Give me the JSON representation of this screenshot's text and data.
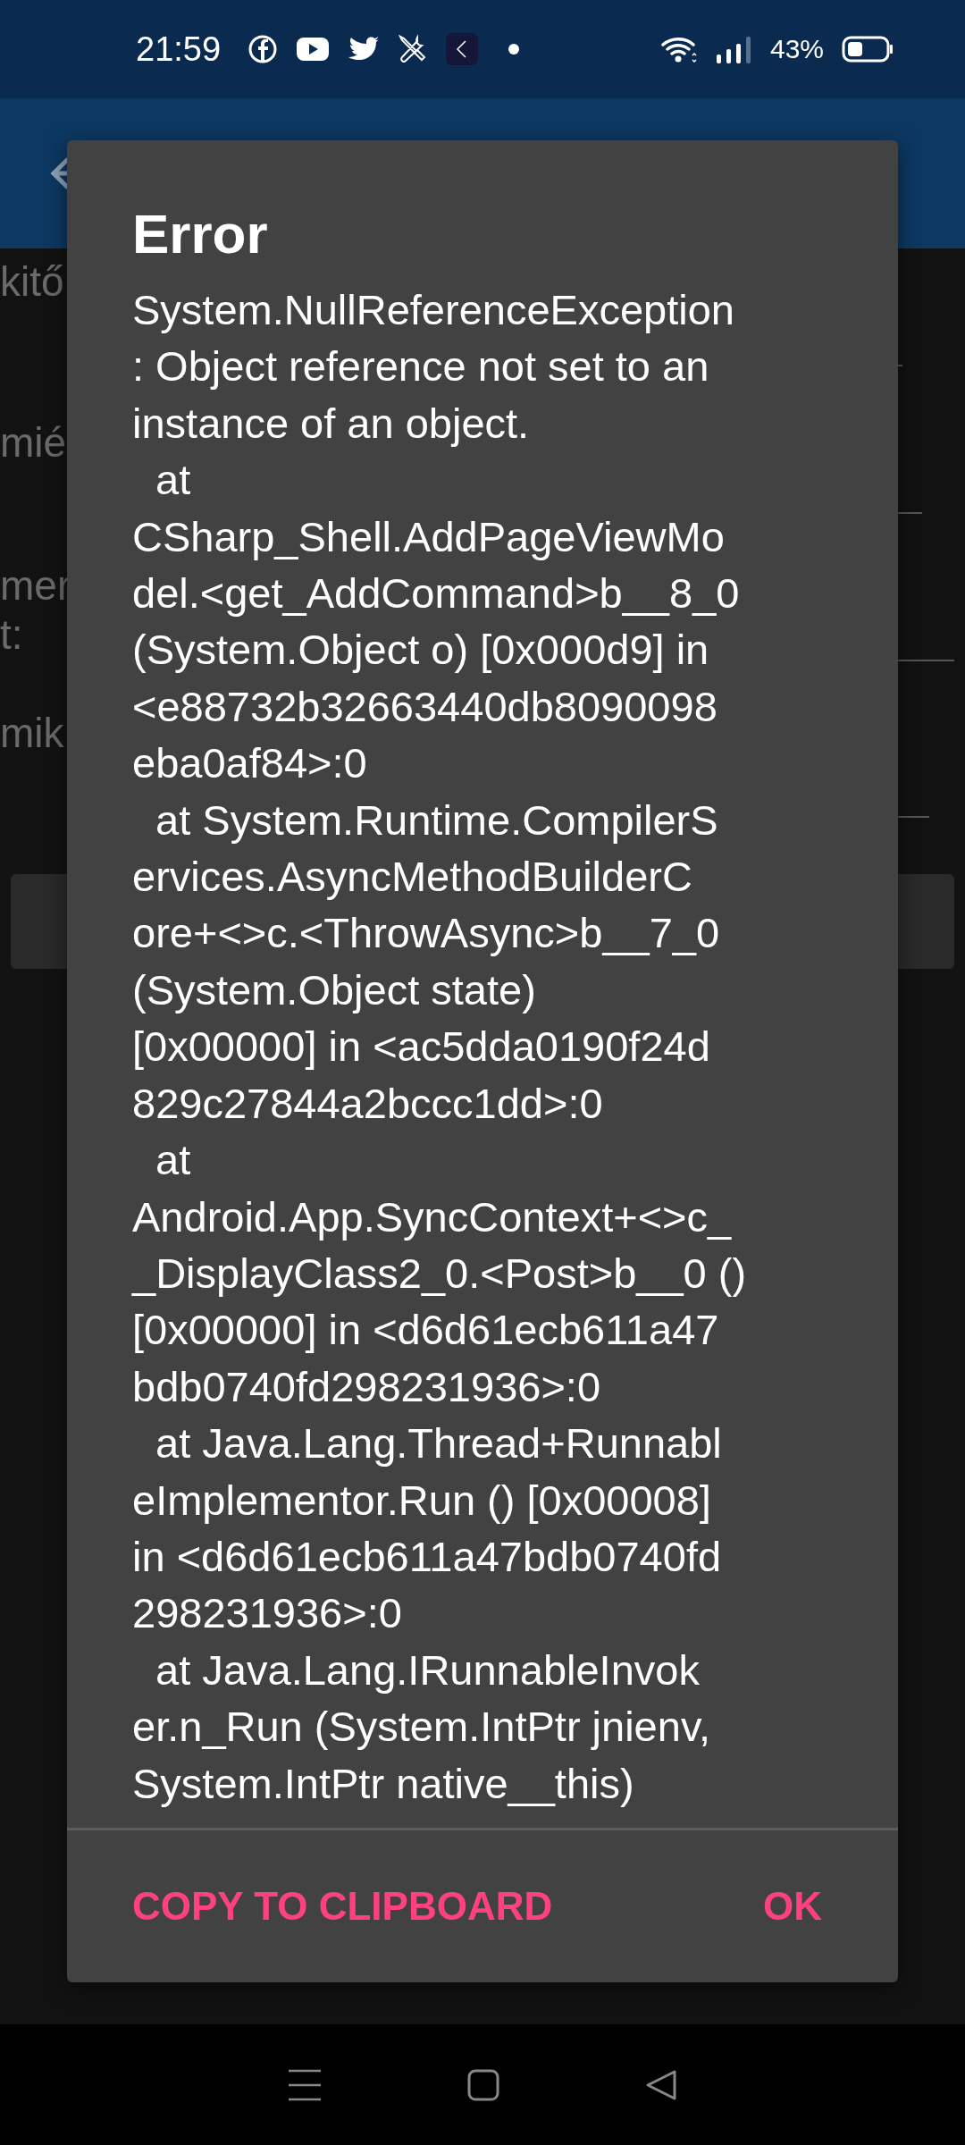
{
  "status_bar": {
    "time": "21:59",
    "battery": "43%"
  },
  "background": {
    "labels": [
      "kitő",
      "mié",
      "mer",
      "t:",
      "mik"
    ]
  },
  "dialog": {
    "title": "Error",
    "message": "System.NullReferenceException\n: Object reference not set to an\ninstance of an object.\n  at\nCSharp_Shell.AddPageViewMo\ndel.<get_AddCommand>b__8_0\n(System.Object o) [0x000d9] in\n<e88732b32663440db8090098\neba0af84>:0\n  at System.Runtime.CompilerS\nervices.AsyncMethodBuilderC\nore+<>c.<ThrowAsync>b__7_0\n(System.Object state)\n[0x00000] in <ac5dda0190f24d\n829c27844a2bccc1dd>:0\n  at\nAndroid.App.SyncContext+<>c_\n_DisplayClass2_0.<Post>b__0 ()\n[0x00000] in <d6d61ecb611a47\nbdb0740fd298231936>:0\n  at Java.Lang.Thread+Runnabl\neImplementor.Run () [0x00008]\nin <d6d61ecb611a47bdb0740fd\n298231936>:0\n  at Java.Lang.IRunnableInvok\ner.n_Run (System.IntPtr jnienv,\nSystem.IntPtr native__this)",
    "buttons": [
      "COPY TO CLIPBOARD",
      "OK"
    ]
  }
}
